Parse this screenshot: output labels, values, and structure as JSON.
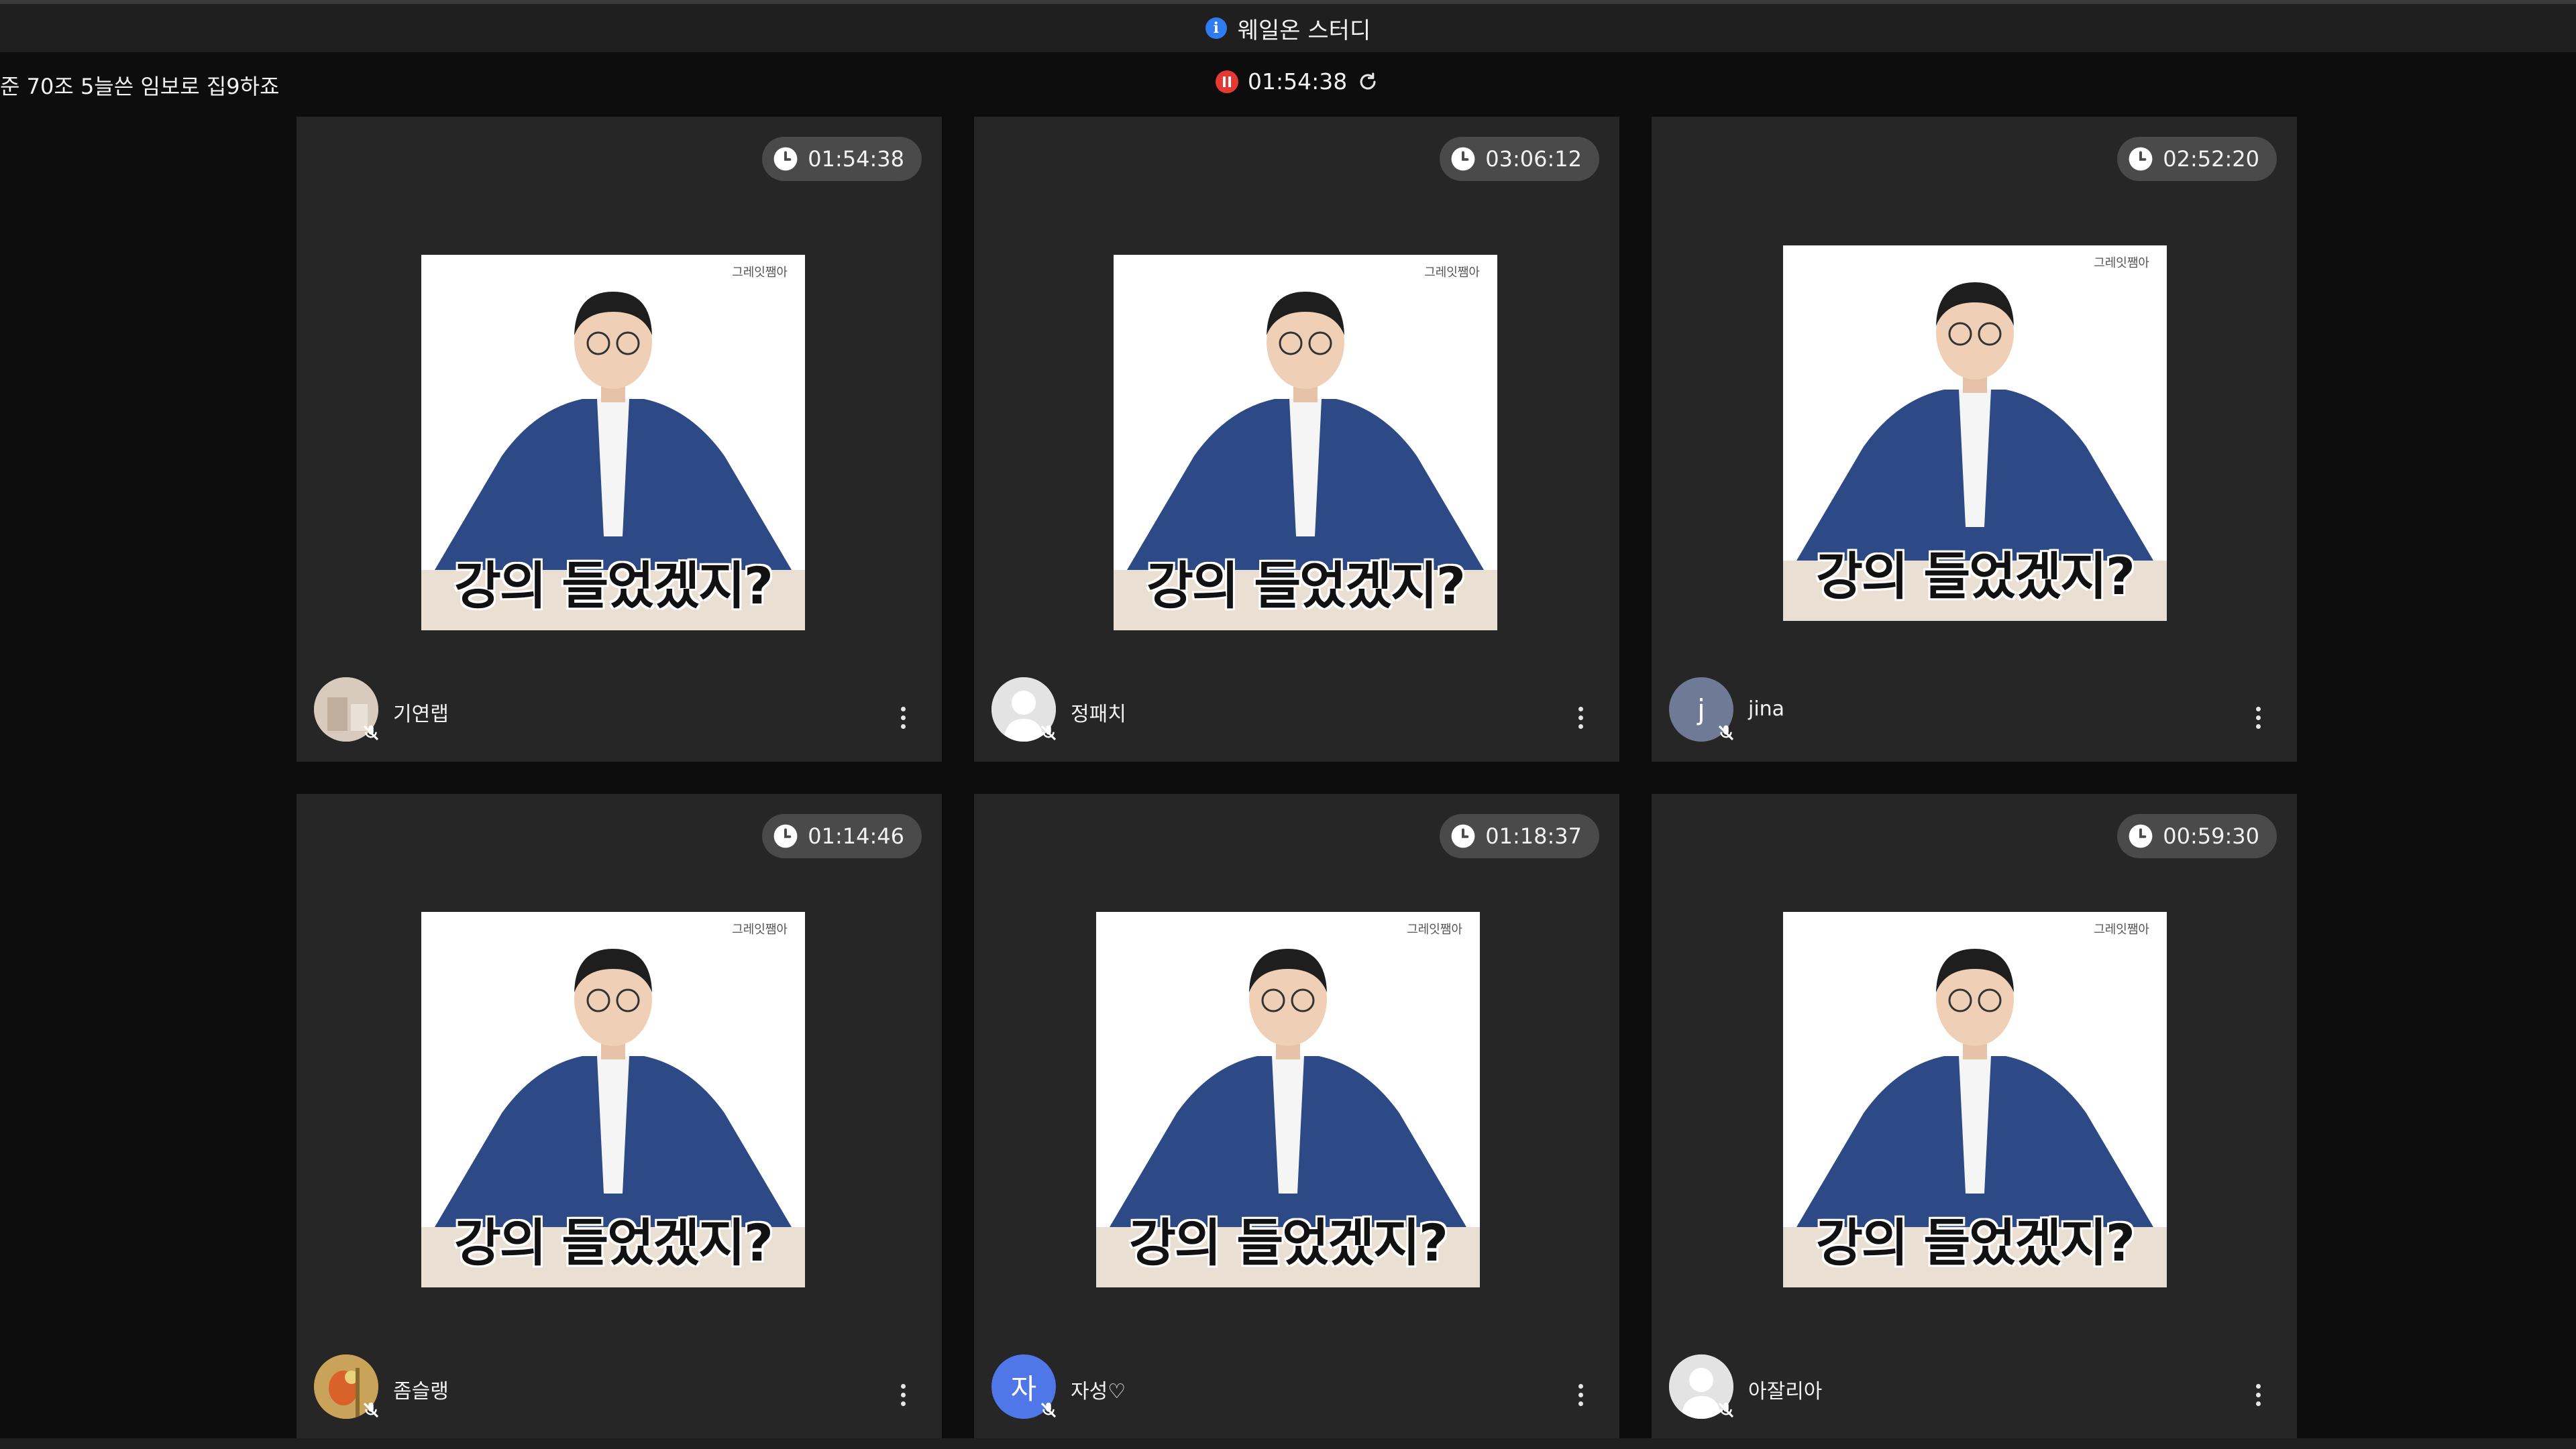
{
  "app": {
    "title": "웨일온 스터디"
  },
  "room": {
    "title": "준 70조 5늘쓴 임보로 집9하죠"
  },
  "session_timer": {
    "time": "01:54:38",
    "state": "paused"
  },
  "photo_content": {
    "brand": "그레잇쨈아",
    "caption": "강의 들었겠지?"
  },
  "colors": {
    "accent": "#2f7cf0",
    "recording": "#e53935",
    "tile_bg": "#262626",
    "badge_bg": "#4a4a4a"
  },
  "participants": [
    {
      "name": "기연랩",
      "timer": "01:54:38",
      "avatar": "photo-room-icon",
      "avatar_color": "#c9b8a6",
      "mic": "muted"
    },
    {
      "name": "정패치",
      "timer": "03:06:12",
      "avatar": "default-person-icon",
      "avatar_color": "#d9d9d9",
      "mic": "muted"
    },
    {
      "name": "jina",
      "avatar_letter": "j",
      "timer": "02:52:20",
      "avatar": "letter",
      "avatar_color": "#6f7a96",
      "mic": "muted"
    },
    {
      "name": "좀슬랭",
      "timer": "01:14:46",
      "avatar": "photo-bird-icon",
      "avatar_color": "#b38a3b",
      "mic": "muted"
    },
    {
      "name": "자성♡",
      "avatar_letter": "자",
      "timer": "01:18:37",
      "avatar": "letter",
      "avatar_color": "#4f77e8",
      "mic": "muted"
    },
    {
      "name": "아잘리아",
      "timer": "00:59:30",
      "avatar": "default-person-icon",
      "avatar_color": "#d9d9d9",
      "mic": "muted"
    }
  ]
}
